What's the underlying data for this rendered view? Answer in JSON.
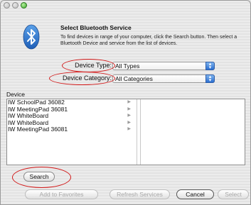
{
  "dialog": {
    "heading": "Select Bluetooth Service",
    "description": "To find devices in range of your computer, click the Search button. Then select a Bluetooth Device and service from the list of devices."
  },
  "device_type": {
    "label": "Device Type:",
    "value": "All Types"
  },
  "device_category": {
    "label": "Device Category:",
    "value": "All Categories"
  },
  "device_list": {
    "header": "Device",
    "items": [
      "IW SchoolPad 36082",
      "IW MeetingPad 36081",
      "IW WhiteBoard",
      "IW WhiteBoard",
      "IW MeetingPad 36081"
    ]
  },
  "buttons": {
    "search": "Search",
    "add_favorites": "Add to Favorites",
    "refresh": "Refresh Services",
    "cancel": "Cancel",
    "select": "Select"
  },
  "annotation_color": "#d21a1a",
  "icons": {
    "window": "bluetooth-icon"
  }
}
